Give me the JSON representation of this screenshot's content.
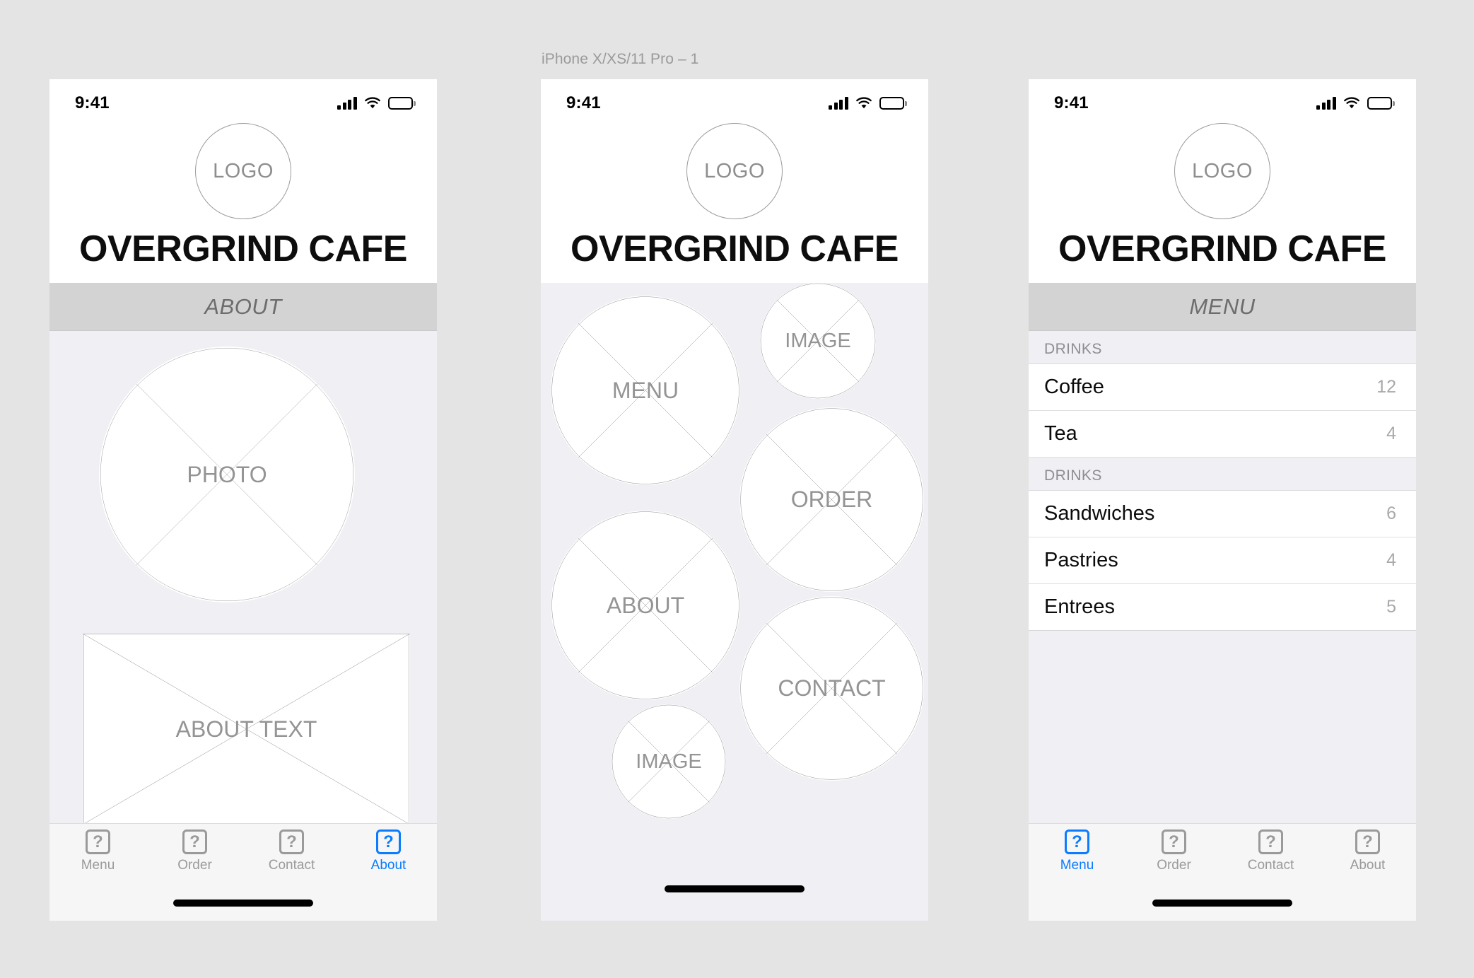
{
  "artboard": {
    "label": "iPhone X/XS/11 Pro – 1"
  },
  "colors": {
    "accent": "#0a7cff",
    "page_bg": "#e4e4e4",
    "screen_bg": "#efeff4",
    "section_bar": "#d3d3d3",
    "placeholder_stroke": "#8e8e8e"
  },
  "status_bar": {
    "time": "9:41",
    "signal_icon": "signal-bars-icon",
    "wifi_icon": "wifi-icon",
    "battery_icon": "battery-full-icon"
  },
  "brand": {
    "logo_label": "LOGO",
    "title": "OVERGRIND CAFE"
  },
  "screens": [
    {
      "id": "about",
      "section_title": "ABOUT",
      "placeholders": [
        {
          "name": "photo-placeholder",
          "label": "PHOTO",
          "shape": "circle"
        },
        {
          "name": "about-text-placeholder",
          "label": "ABOUT TEXT",
          "shape": "rect"
        }
      ],
      "tabbar": {
        "items": [
          {
            "label": "Menu",
            "icon": "question-placeholder-icon",
            "active": false
          },
          {
            "label": "Order",
            "icon": "question-placeholder-icon",
            "active": false
          },
          {
            "label": "Contact",
            "icon": "question-placeholder-icon",
            "active": false
          },
          {
            "label": "About",
            "icon": "question-placeholder-icon",
            "active": true
          }
        ]
      }
    },
    {
      "id": "home",
      "section_title": "",
      "placeholders": [
        {
          "name": "menu-circle-placeholder",
          "label": "MENU",
          "shape": "circle"
        },
        {
          "name": "image-circle-placeholder-1",
          "label": "IMAGE",
          "shape": "circle"
        },
        {
          "name": "order-circle-placeholder",
          "label": "ORDER",
          "shape": "circle"
        },
        {
          "name": "about-circle-placeholder",
          "label": "ABOUT",
          "shape": "circle"
        },
        {
          "name": "contact-circle-placeholder",
          "label": "CONTACT",
          "shape": "circle"
        },
        {
          "name": "image-circle-placeholder-2",
          "label": "IMAGE",
          "shape": "circle"
        }
      ],
      "tabbar": null
    },
    {
      "id": "menu",
      "section_title": "MENU",
      "list": {
        "sections": [
          {
            "header": "DRINKS",
            "rows": [
              {
                "label": "Coffee",
                "value": "12"
              },
              {
                "label": "Tea",
                "value": "4"
              }
            ]
          },
          {
            "header": "DRINKS",
            "rows": [
              {
                "label": "Sandwiches",
                "value": "6"
              },
              {
                "label": "Pastries",
                "value": "4"
              },
              {
                "label": "Entrees",
                "value": "5"
              }
            ]
          }
        ]
      },
      "tabbar": {
        "items": [
          {
            "label": "Menu",
            "icon": "question-placeholder-icon",
            "active": true
          },
          {
            "label": "Order",
            "icon": "question-placeholder-icon",
            "active": false
          },
          {
            "label": "Contact",
            "icon": "question-placeholder-icon",
            "active": false
          },
          {
            "label": "About",
            "icon": "question-placeholder-icon",
            "active": false
          }
        ]
      }
    }
  ]
}
